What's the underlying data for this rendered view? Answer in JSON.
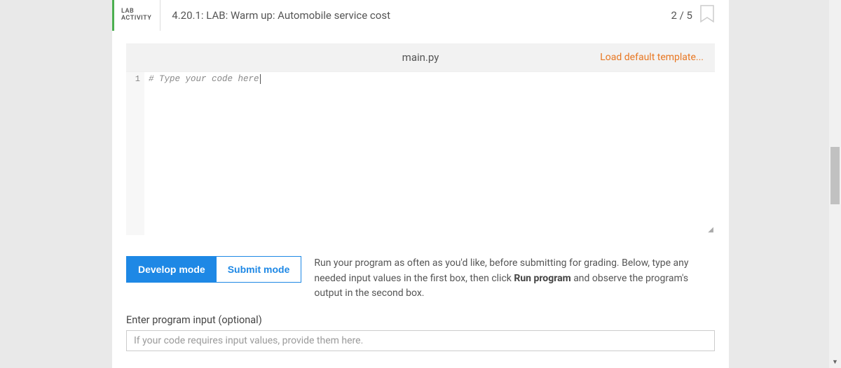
{
  "header": {
    "badge_line1": "LAB",
    "badge_line2": "ACTIVITY",
    "title": "4.20.1: LAB: Warm up: Automobile service cost",
    "score": "2 / 5"
  },
  "editor": {
    "filename": "main.py",
    "load_template": "Load default template...",
    "line_numbers": [
      "1"
    ],
    "code_line": "# Type your code here"
  },
  "mode": {
    "develop": "Develop mode",
    "submit": "Submit mode"
  },
  "instructions": {
    "pre": "Run your program as often as you'd like, before submitting for grading. Below, type any needed input values in the first box, then click ",
    "bold": "Run program",
    "post": " and observe the program's output in the second box."
  },
  "input": {
    "label": "Enter program input (optional)",
    "placeholder": "If your code requires input values, provide them here."
  }
}
